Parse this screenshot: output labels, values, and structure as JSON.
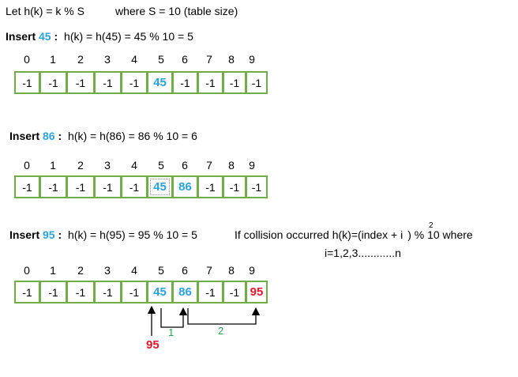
{
  "header": {
    "formula": "Let h(k) = k % S",
    "where": "where S = 10 (table size)"
  },
  "step1": {
    "insert_label": "Insert",
    "key": "45",
    "colon": ":",
    "hash_text": "h(k) = h(45) = 45 % 10 = 5",
    "indices": [
      "0",
      "1",
      "2",
      "3",
      "4",
      "5",
      "6",
      "7",
      "8",
      "9"
    ],
    "cells": [
      "-1",
      "-1",
      "-1",
      "-1",
      "-1",
      "45",
      "-1",
      "-1",
      "-1",
      "-1"
    ]
  },
  "step2": {
    "insert_label": "Insert",
    "key": "86",
    "colon": ":",
    "hash_text": "h(k) = h(86) = 86 % 10 = 6",
    "indices": [
      "0",
      "1",
      "2",
      "3",
      "4",
      "5",
      "6",
      "7",
      "8",
      "9"
    ],
    "cells": [
      "-1",
      "-1",
      "-1",
      "-1",
      "-1",
      "45",
      "86",
      "-1",
      "-1",
      "-1"
    ]
  },
  "step3": {
    "insert_label": "Insert",
    "key": "95",
    "colon": ":",
    "hash_text": "h(k) = h(95) = 95 % 10 = 5",
    "collision_text": "If collision occurred h(k)=(index + i",
    "collision_text_end": ") % 10  where",
    "superscript": "2",
    "i_values": "i=1,2,3............n",
    "indices": [
      "0",
      "1",
      "2",
      "3",
      "4",
      "5",
      "6",
      "7",
      "8",
      "9"
    ],
    "cells": [
      "-1",
      "-1",
      "-1",
      "-1",
      "-1",
      "45",
      "86",
      "-1",
      "-1",
      "95"
    ],
    "probe_key": "95",
    "probe_1": "1",
    "probe_2": "2"
  },
  "colors": {
    "cell_border": "#70ad47",
    "key_blue": "#29a3e0",
    "key_red": "#e0182d",
    "probe_green": "#22a745"
  }
}
